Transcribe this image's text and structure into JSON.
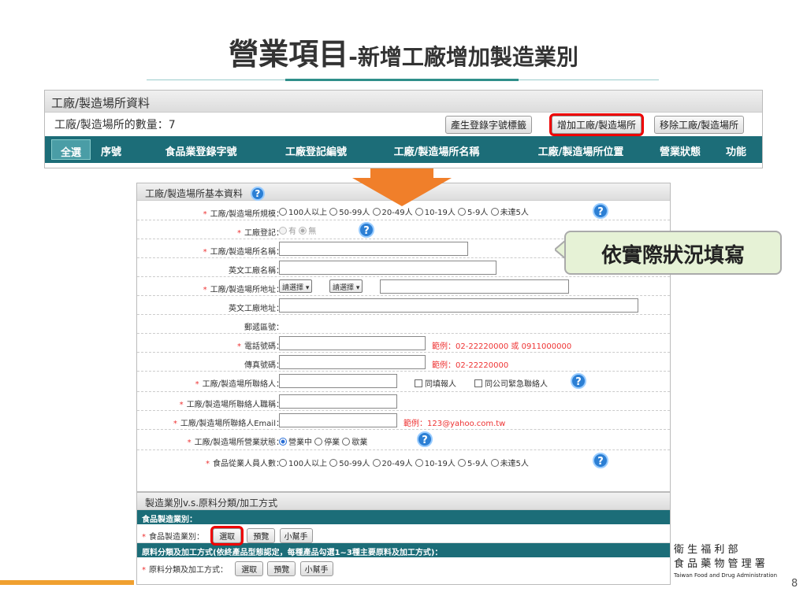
{
  "slide": {
    "title_main": "營業項目",
    "title_sep": "-",
    "title_sub": "新增工廠增加製造業別",
    "callout": "依實際狀況填寫",
    "page_number": "8",
    "org_line1": "衛 生 福 利 部",
    "org_line2": "食 品 藥 物 管 理 署",
    "org_line3": "Taiwan Food and Drug Administration"
  },
  "factory_list": {
    "header": "工廠/製造場所資料",
    "count_label": "工廠/製造場所的數量：7",
    "buttons": {
      "generate_label": "產生登錄字號標籤",
      "add_label": "增加工廠/製造場所",
      "remove_label": "移除工廠/製造場所"
    },
    "columns": {
      "select_all": "全選",
      "seq": "序號",
      "reg_no": "食品業登錄字號",
      "factory_reg_no": "工廠登記編號",
      "name": "工廠/製造場所名稱",
      "location": "工廠/製造場所位置",
      "status": "營業狀態",
      "function": "功能"
    }
  },
  "basic_info": {
    "header": "工廠/製造場所基本資料",
    "scale": {
      "label": "工廠/製造場所規模：",
      "options": [
        "100人以上",
        "50-99人",
        "20-49人",
        "10-19人",
        "5-9人",
        "未達5人"
      ]
    },
    "factory_reg": {
      "label": "工廠登記：",
      "opt_yes": "有",
      "opt_no": "無"
    },
    "name": {
      "label": "工廠/製造場所名稱："
    },
    "en_name": {
      "label": "英文工廠名稱："
    },
    "address": {
      "label": "工廠/製造場所地址：",
      "select1": "請選擇",
      "select2": "請選擇"
    },
    "en_address": {
      "label": "英文工廠地址："
    },
    "postal": {
      "label": "郵遞區號："
    },
    "phone": {
      "label": "電話號碼：",
      "example": "範例：02-22220000 或 0911000000"
    },
    "fax": {
      "label": "傳真號碼：",
      "example": "範例：02-22220000"
    },
    "contact": {
      "label": "工廠/製造場所聯絡人：",
      "same_as_reporter": "同填報人",
      "same_as_company": "同公司緊急聯絡人"
    },
    "contact_title": {
      "label": "工廠/製造場所聯絡人職稱："
    },
    "contact_email": {
      "label": "工廠/製造場所聯絡人Email：",
      "example": "範例：123@yahoo.com.tw"
    },
    "business_status": {
      "label": "工廠/製造場所營業狀態：",
      "options": [
        "營業中",
        "停業",
        "歇業"
      ]
    },
    "employees": {
      "label": "食品從業人員人數：",
      "options": [
        "100人以上",
        "50-99人",
        "20-49人",
        "10-19人",
        "5-9人",
        "未達5人"
      ]
    }
  },
  "manufacturing": {
    "header": "製造業別v.s.原料分類/加工方式",
    "category_bar": "食品製造業別：",
    "category_label": "食品製造業別：",
    "material_bar": "原料分類及加工方式(依終產品型態認定，每種產品勾選1~3種主要原料及加工方式)：",
    "material_label": "原料分類及加工方式：",
    "btn_select": "選取",
    "btn_preview": "預覽",
    "btn_helper": "小幫手"
  },
  "colors": {
    "accent_teal": "#1c6d78",
    "highlight_red": "#e00000",
    "arrow_orange": "#f07f2a",
    "callout_bg": "#e6f2d6"
  }
}
